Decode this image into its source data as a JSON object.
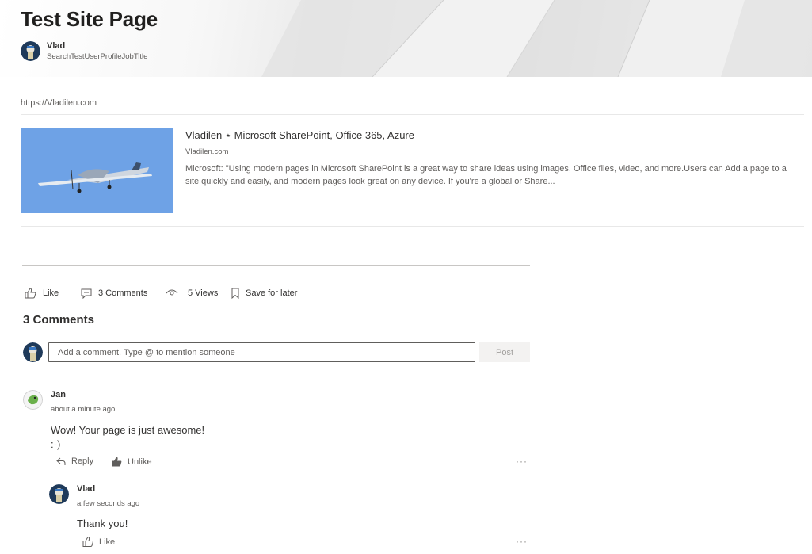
{
  "header": {
    "title": "Test Site Page",
    "author_name": "Vlad",
    "author_job_title": "SearchTestUserProfileJobTitle"
  },
  "link_preview": {
    "url": "https://Vladilen.com",
    "title": "Vladilen ⋆ Microsoft SharePoint, Office 365, Azure",
    "domain": "Vladilen.com",
    "description": "Microsoft: \"Using modern pages in Microsoft SharePoint is a great way to share ideas using images, Office files, video, and more.Users can Add a page to a site quickly and easily, and modern pages look great on any device. If you're a global or Share..."
  },
  "social_bar": {
    "like_label": "Like",
    "comments_label": "3 Comments",
    "views_label": "5 Views",
    "save_label": "Save for later"
  },
  "comments": {
    "heading": "3 Comments",
    "input_placeholder": "Add a comment. Type @ to mention someone",
    "post_label": "Post",
    "items": [
      {
        "author": "Jan",
        "time": "about a minute ago",
        "text_line1": "Wow! Your page is just awesome!",
        "text_line2": ":-)",
        "reply_label": "Reply",
        "like_label": "Unlike",
        "more": "···"
      },
      {
        "author": "Vlad",
        "time": "a few seconds ago",
        "text_line1": "Thank you!",
        "like_label": "Like",
        "more": "···"
      }
    ]
  },
  "colors": {
    "accent": "#0078d4",
    "text": "#323130",
    "secondary_text": "#605e5c",
    "sky": "#6ea2e6"
  }
}
